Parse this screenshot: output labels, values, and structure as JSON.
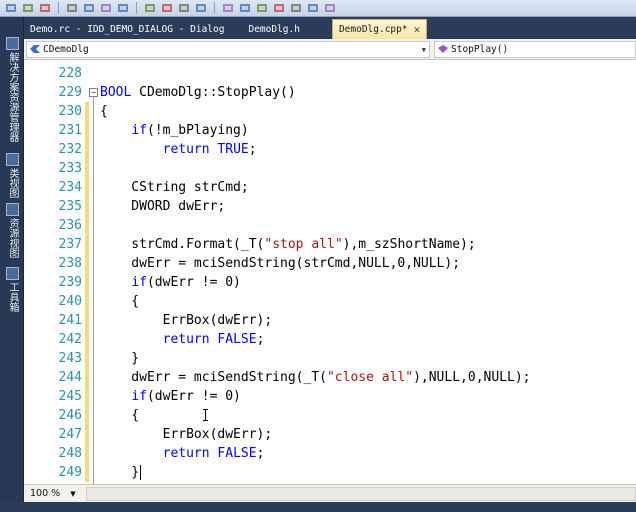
{
  "colors": {
    "keyword": "#0000ff",
    "string": "#a31515",
    "line_number": "#2b91af",
    "change_bar": "#f1dc7c",
    "chrome": "#2b3c59"
  },
  "toolbar": {
    "icons": [
      "toolbar-icon-1",
      "toolbar-icon-2",
      "toolbar-icon-3",
      "toolbar-icon-4",
      "toolbar-icon-5",
      "toolbar-icon-6",
      "toolbar-icon-7",
      "toolbar-icon-8",
      "toolbar-icon-9",
      "toolbar-icon-10",
      "toolbar-icon-11",
      "toolbar-icon-12",
      "toolbar-icon-13",
      "toolbar-icon-14",
      "toolbar-icon-15",
      "toolbar-icon-16",
      "toolbar-icon-17",
      "toolbar-icon-18"
    ]
  },
  "side_panel": {
    "tabs": [
      {
        "label": "解决方案资源管理器",
        "icon": "solution-explorer-icon"
      },
      {
        "label": "类视图",
        "icon": "class-view-icon"
      },
      {
        "label": "资源视图",
        "icon": "resource-view-icon"
      },
      {
        "label": "工具箱",
        "icon": "toolbox-icon"
      }
    ]
  },
  "tabs": [
    {
      "label": "Demo.rc - IDD_DEMO_DIALOG - Dialog",
      "active": false
    },
    {
      "label": "DemoDlg.h",
      "active": false
    },
    {
      "label": "DemoDlg.cpp*",
      "active": true,
      "close": "✕"
    }
  ],
  "navbar": {
    "class_scope": "CDemoDlg",
    "member": "StopPlay()"
  },
  "editor": {
    "lines": [
      {
        "num": "228",
        "code": ""
      },
      {
        "num": "229",
        "code": "BOOL CDemoDlg::StopPlay()"
      },
      {
        "num": "230",
        "code": "{"
      },
      {
        "num": "231",
        "code": "    if(!m_bPlaying)"
      },
      {
        "num": "232",
        "code": "        return TRUE;"
      },
      {
        "num": "233",
        "code": ""
      },
      {
        "num": "234",
        "code": "    CString strCmd;"
      },
      {
        "num": "235",
        "code": "    DWORD dwErr;"
      },
      {
        "num": "236",
        "code": ""
      },
      {
        "num": "237",
        "code": "    strCmd.Format(_T(\"stop all\"),m_szShortName);"
      },
      {
        "num": "238",
        "code": "    dwErr = mciSendString(strCmd,NULL,0,NULL);"
      },
      {
        "num": "239",
        "code": "    if(dwErr != 0)"
      },
      {
        "num": "240",
        "code": "    {"
      },
      {
        "num": "241",
        "code": "        ErrBox(dwErr);"
      },
      {
        "num": "242",
        "code": "        return FALSE;"
      },
      {
        "num": "243",
        "code": "    }"
      },
      {
        "num": "244",
        "code": "    dwErr = mciSendString(_T(\"close all\"),NULL,0,NULL);"
      },
      {
        "num": "245",
        "code": "    if(dwErr != 0)"
      },
      {
        "num": "246",
        "code": "    {"
      },
      {
        "num": "247",
        "code": "        ErrBox(dwErr);"
      },
      {
        "num": "248",
        "code": "        return FALSE;"
      },
      {
        "num": "249",
        "code": "    }"
      }
    ]
  },
  "status": {
    "zoom": "100 %"
  }
}
